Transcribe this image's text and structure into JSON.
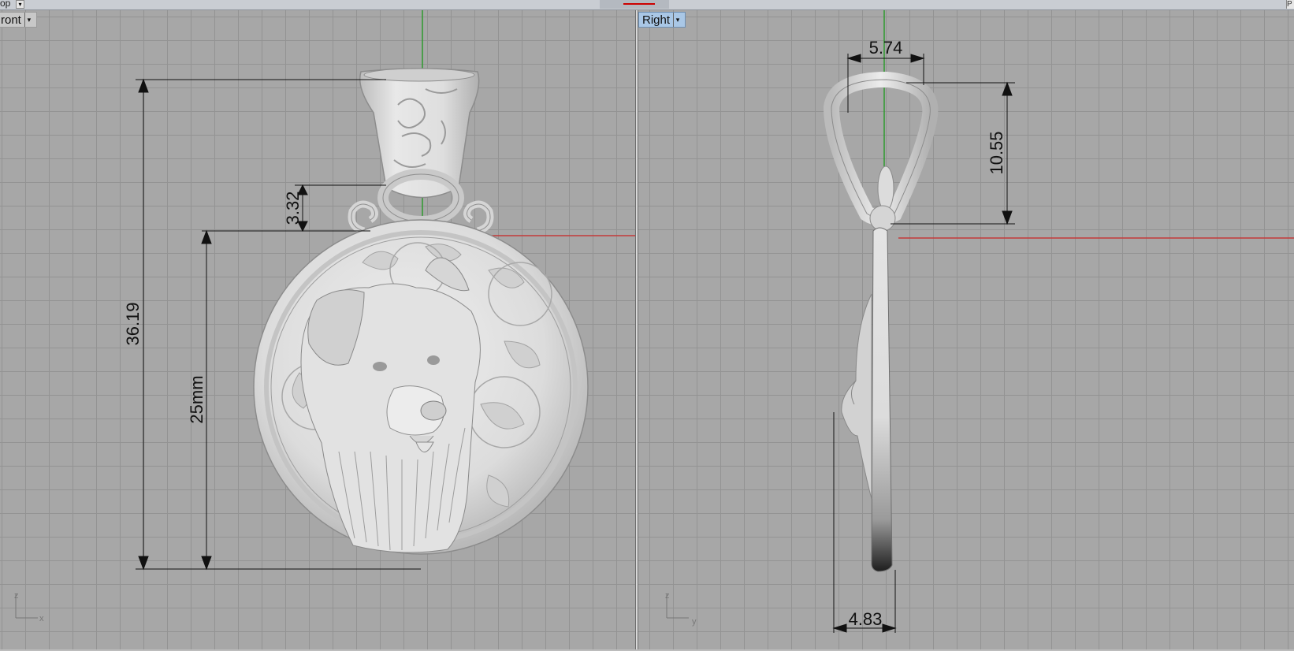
{
  "toolbar": {
    "left_label": "op",
    "right_label": "P"
  },
  "viewports": {
    "front": {
      "label": "ront",
      "dimensions": {
        "total_height": "36.19",
        "disc_diameter": "25mm",
        "loop_gap": "3.32"
      },
      "axes": {
        "vertical": "z",
        "horizontal": "x"
      },
      "object": "dog-pendant-front"
    },
    "right": {
      "label": "Right",
      "dimensions": {
        "bail_width": "5.74",
        "bail_height": "10.55",
        "thickness": "4.83"
      },
      "axes": {
        "vertical": "z",
        "horizontal": "y"
      },
      "object": "dog-pendant-side"
    }
  },
  "colors": {
    "x_axis": "#c43a3a",
    "y_axis": "#2e9a2e",
    "grid": "#939393",
    "background": "#a7a7a7",
    "active_label": "#a9c7e6"
  }
}
